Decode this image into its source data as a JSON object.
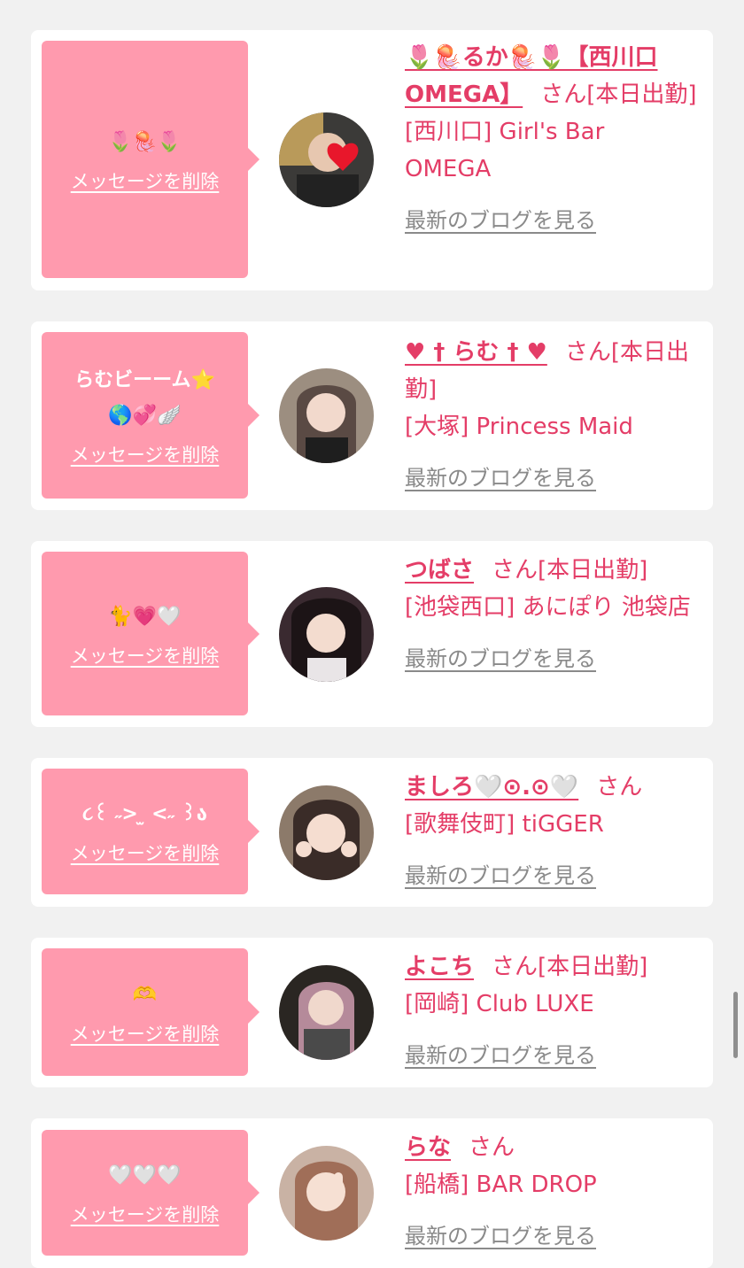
{
  "delete_label": "メッセージを削除",
  "blog_label": "最新のブログを見る",
  "san_label": "さん",
  "cards": [
    {
      "message": "🌷🪼🌷",
      "name": "🌷🪼るか🪼🌷【西川口OMEGA】",
      "status": "[本日出勤]",
      "shop": "[西川口] Girl's Bar OMEGA"
    },
    {
      "message": "らむビーーム⭐️\n🌎💞🪽",
      "name": "♥︎ † らむ † ♥︎",
      "status": "[本日出勤]",
      "shop": "[大塚] Princess Maid"
    },
    {
      "message": "🐈💗🤍",
      "name": "つばさ",
      "status": "[本日出勤]",
      "shop": "[池袋西口] あにぽり 池袋店"
    },
    {
      "message": "૮꒰ ˶> ̫ <˶ ꒱ა",
      "name": "ましろ🤍⊙.⊙🤍",
      "status": "",
      "shop": "[歌舞伎町] tiGGER"
    },
    {
      "message": "🫶",
      "name": "よこち",
      "status": "[本日出勤]",
      "shop": "[岡崎] Club LUXE"
    },
    {
      "message": "🤍🤍🤍",
      "name": "らな",
      "status": "",
      "shop": "[船橋] BAR DROP"
    }
  ],
  "colors": {
    "accent": "#e43d67",
    "bubble": "#ff9aae",
    "link_gray": "#8a8a8a",
    "background": "#f1f1f1"
  }
}
